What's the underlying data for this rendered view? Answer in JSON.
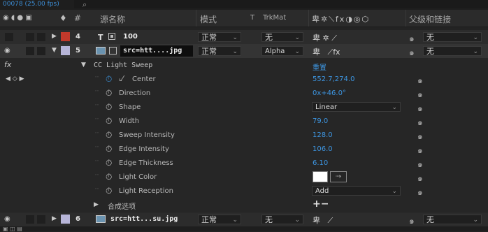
{
  "timecode": "00078 (25.00 fps)",
  "search": {
    "placeholder": ""
  },
  "header": {
    "hash": "#",
    "source_name": "源名称",
    "mode": "模式",
    "t": "T",
    "trkmat": "TrkMat",
    "parent": "父级和链接"
  },
  "layers": [
    {
      "num": "4",
      "type_icon": "T",
      "name": "100",
      "label_color": "#c0392b",
      "mode": "正常",
      "trkmat": "无",
      "parent": "无"
    },
    {
      "num": "5",
      "name": "src=htt....jpg",
      "label_color": "#b7b5d8",
      "mode": "正常",
      "trkmat": "Alpha",
      "parent": "无"
    },
    {
      "num": "6",
      "name": "src=htt...su.jpg",
      "label_color": "#b7b5d8",
      "mode": "正常",
      "trkmat": "无",
      "parent": "无"
    }
  ],
  "effect": {
    "name": "CC Light Sweep",
    "reset": "重置",
    "properties": [
      {
        "name": "Center",
        "value": "552.7,274.0"
      },
      {
        "name": "Direction",
        "value": "0x+46.0°"
      },
      {
        "name": "Shape",
        "value": "Linear"
      },
      {
        "name": "Width",
        "value": "79.0"
      },
      {
        "name": "Sweep Intensity",
        "value": "128.0"
      },
      {
        "name": "Edge Intensity",
        "value": "106.0"
      },
      {
        "name": "Edge Thickness",
        "value": "6.10"
      },
      {
        "name": "Light Color",
        "value": ""
      },
      {
        "name": "Light Reception",
        "value": "Add"
      }
    ]
  },
  "compositing_options": "合成选项",
  "plus_minus": "+−",
  "fx_label": "fx",
  "icons": {
    "search": "search-icon",
    "watch": "stopwatch-icon",
    "spiral": "pickwhip-icon",
    "eyedropper": "eyedropper-icon"
  },
  "colors": {
    "accent": "#3d95e0",
    "label_red": "#c0392b",
    "label_lavender": "#b7b5d8"
  }
}
